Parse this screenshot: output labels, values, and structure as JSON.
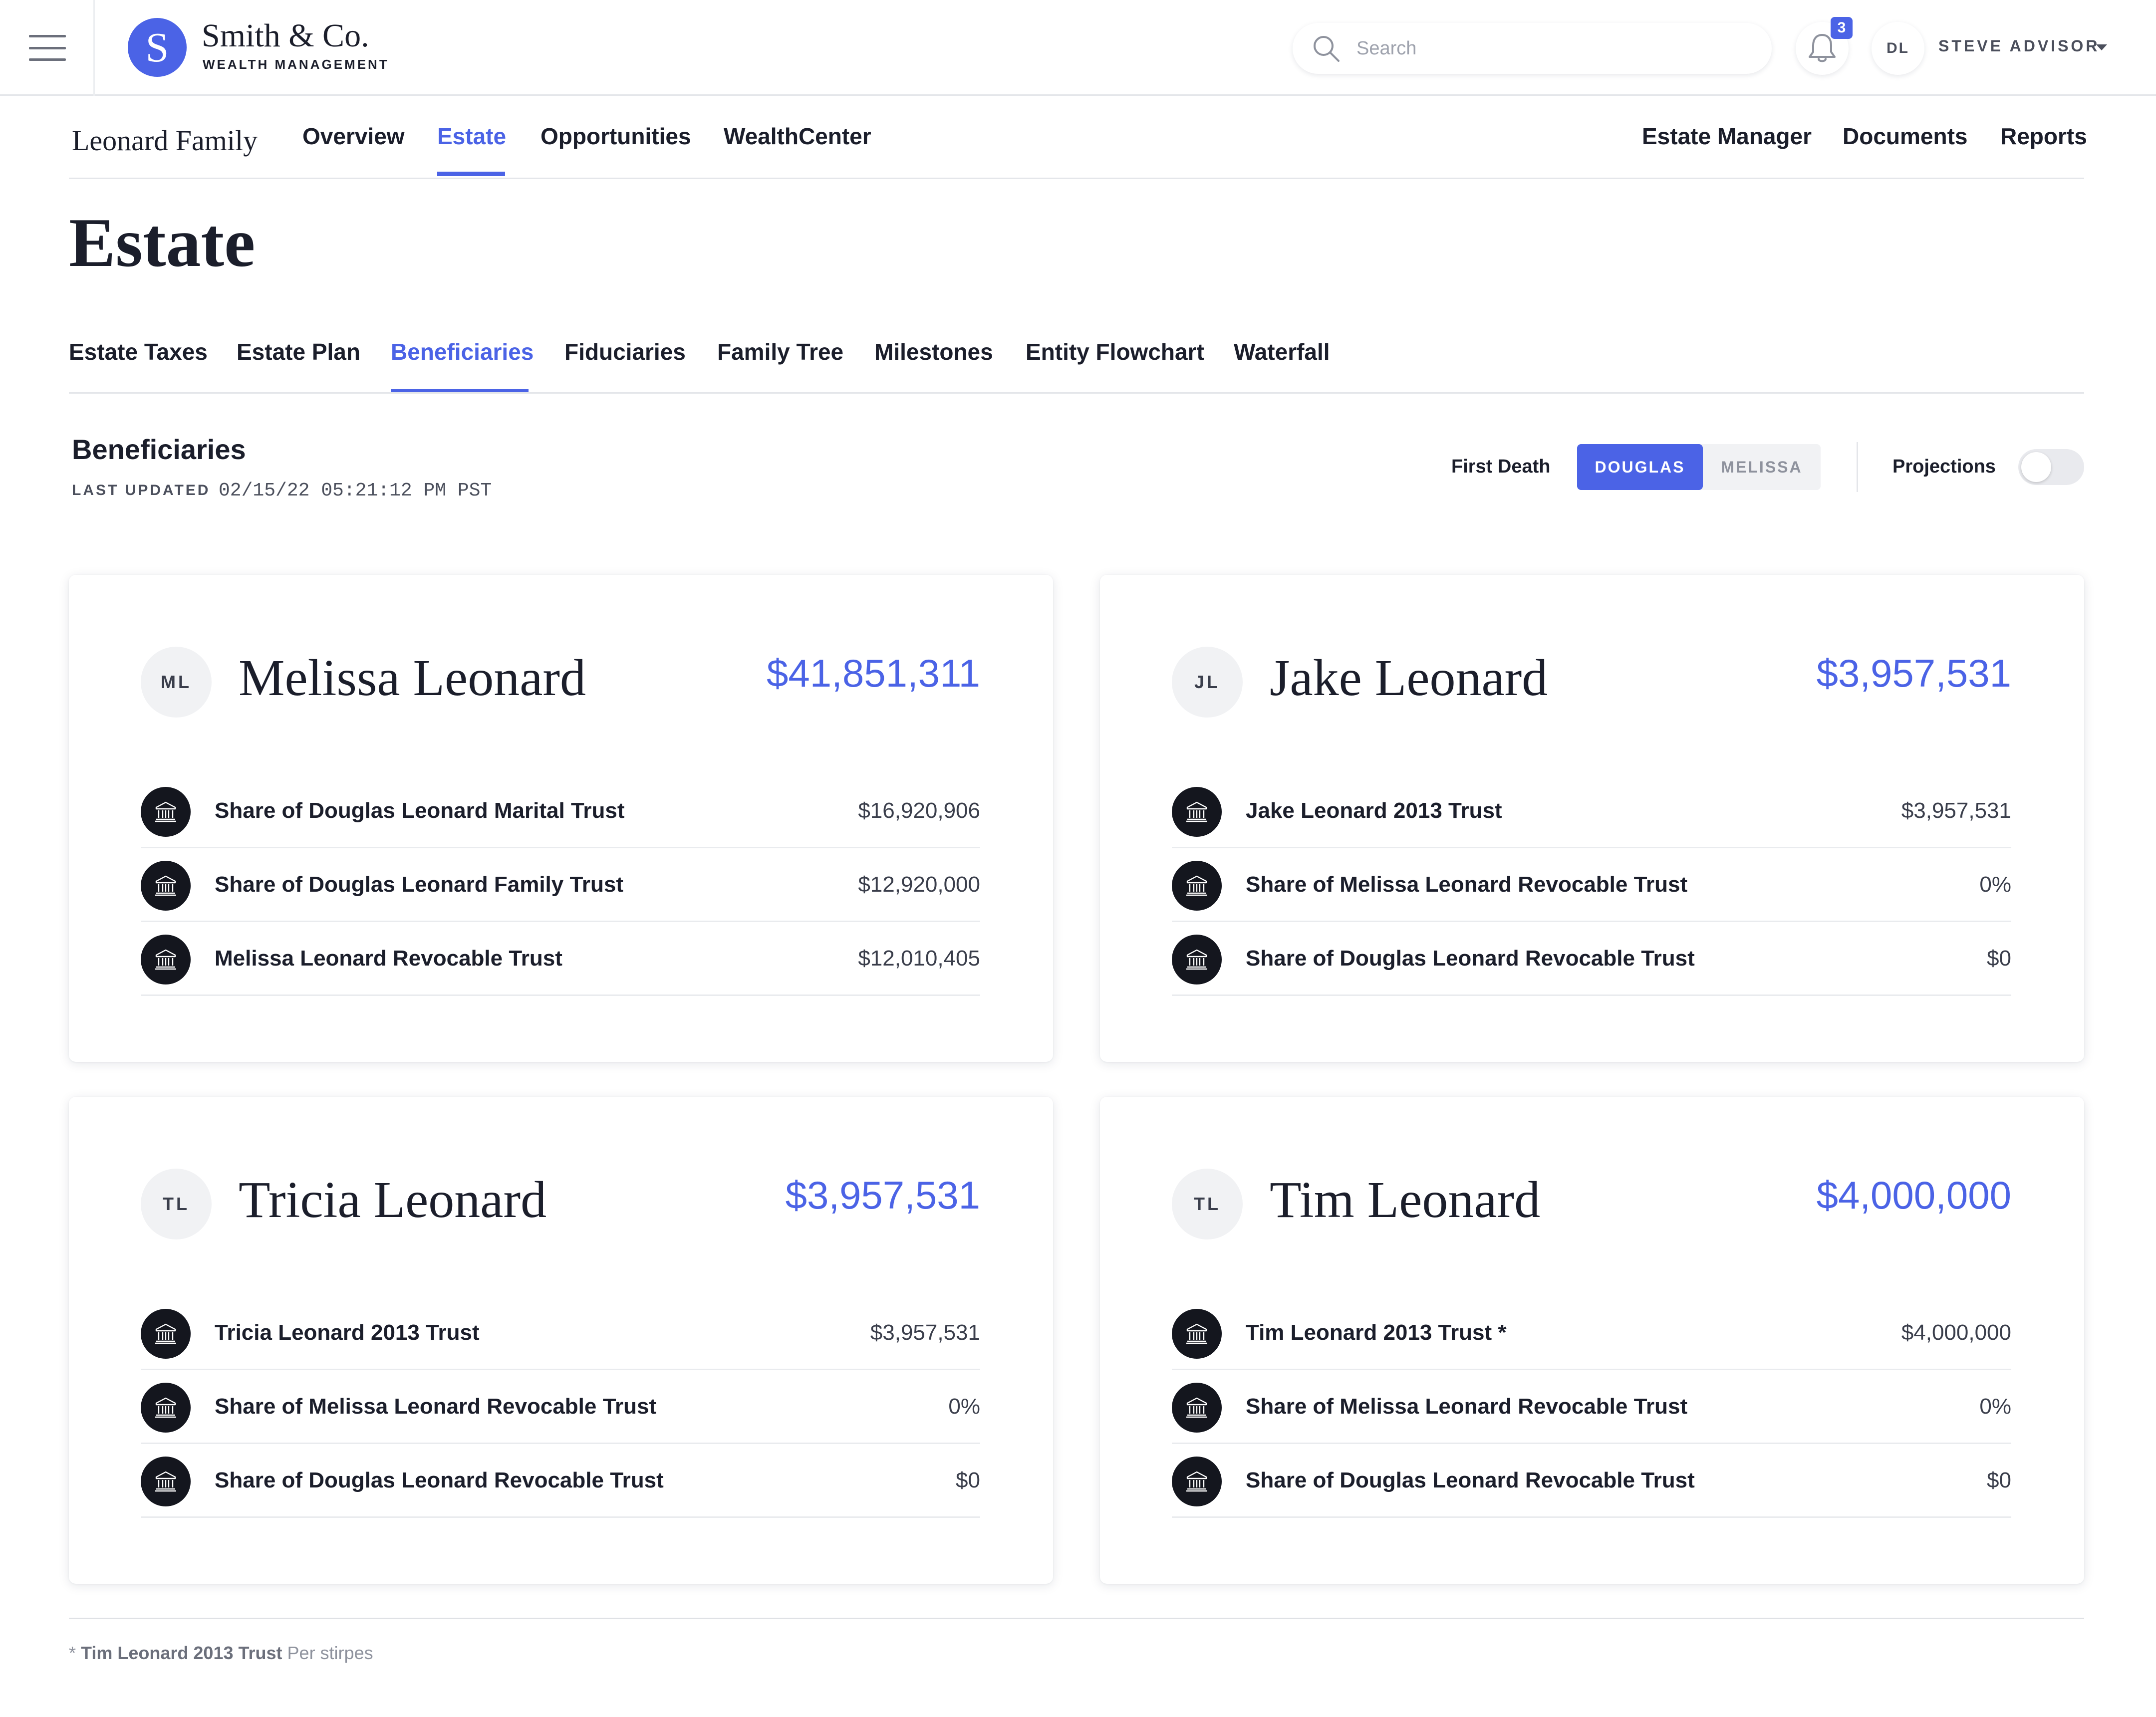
{
  "brand": {
    "logo_letter": "S",
    "name": "Smith & Co.",
    "subtitle": "WEALTH MANAGEMENT"
  },
  "search": {
    "placeholder": "Search",
    "value": ""
  },
  "notifications": {
    "count": "3"
  },
  "user": {
    "initials": "DL",
    "name": "STEVE ADVISOR"
  },
  "family": {
    "name": "Leonard Family"
  },
  "main_nav": {
    "left": [
      {
        "label": "Overview",
        "active": false
      },
      {
        "label": "Estate",
        "active": true
      },
      {
        "label": "Opportunities",
        "active": false
      },
      {
        "label": "WealthCenter",
        "active": false
      }
    ],
    "right": [
      {
        "label": "Estate Manager"
      },
      {
        "label": "Documents"
      },
      {
        "label": "Reports"
      }
    ]
  },
  "page": {
    "title": "Estate"
  },
  "sub_tabs": [
    {
      "label": "Estate Taxes",
      "active": false
    },
    {
      "label": "Estate Plan",
      "active": false
    },
    {
      "label": "Beneficiaries",
      "active": true
    },
    {
      "label": "Fiduciaries",
      "active": false
    },
    {
      "label": "Family Tree",
      "active": false
    },
    {
      "label": "Milestones",
      "active": false
    },
    {
      "label": "Entity Flowchart",
      "active": false
    },
    {
      "label": "Waterfall",
      "active": false
    }
  ],
  "section": {
    "title": "Beneficiaries",
    "last_updated_label": "LAST UPDATED",
    "last_updated_value": "02/15/22 05:21:12 PM PST",
    "first_death_label": "First Death",
    "first_death_options": [
      "DOUGLAS",
      "MELISSA"
    ],
    "first_death_selected": "DOUGLAS",
    "projections_label": "Projections",
    "projections_on": false
  },
  "beneficiaries": [
    {
      "initials": "ML",
      "name": "Melissa Leonard",
      "total": "$41,851,311",
      "items": [
        {
          "label": "Share of Douglas Leonard Marital Trust",
          "value": "$16,920,906"
        },
        {
          "label": "Share of Douglas Leonard Family Trust",
          "value": "$12,920,000"
        },
        {
          "label": "Melissa Leonard Revocable Trust",
          "value": "$12,010,405"
        }
      ]
    },
    {
      "initials": "JL",
      "name": "Jake Leonard",
      "total": "$3,957,531",
      "items": [
        {
          "label": "Jake Leonard 2013 Trust",
          "value": "$3,957,531"
        },
        {
          "label": "Share of Melissa Leonard Revocable Trust",
          "value": "0%"
        },
        {
          "label": "Share of Douglas Leonard Revocable Trust",
          "value": "$0"
        }
      ]
    },
    {
      "initials": "TL",
      "name": "Tricia Leonard",
      "total": "$3,957,531",
      "items": [
        {
          "label": "Tricia Leonard 2013 Trust",
          "value": "$3,957,531"
        },
        {
          "label": "Share of Melissa Leonard Revocable Trust",
          "value": "0%"
        },
        {
          "label": "Share of Douglas Leonard Revocable Trust",
          "value": "$0"
        }
      ]
    },
    {
      "initials": "TL",
      "name": "Tim Leonard",
      "total": "$4,000,000",
      "items": [
        {
          "label": "Tim Leonard 2013 Trust *",
          "value": "$4,000,000"
        },
        {
          "label": "Share of Melissa Leonard Revocable Trust",
          "value": "0%"
        },
        {
          "label": "Share of Douglas Leonard Revocable Trust",
          "value": "$0"
        }
      ]
    }
  ],
  "footnote": {
    "marker": "*",
    "name": "Tim Leonard 2013 Trust",
    "text": "Per stirpes"
  },
  "colors": {
    "accent": "#4b63e6",
    "text": "#1b1e2b",
    "muted": "#8e929d",
    "icon_bg": "#14161e"
  },
  "icons": {
    "menu": "hamburger-icon",
    "search": "search-icon",
    "notifications": "bell-icon",
    "dropdown": "chevron-down-icon",
    "trust": "bank-icon"
  }
}
